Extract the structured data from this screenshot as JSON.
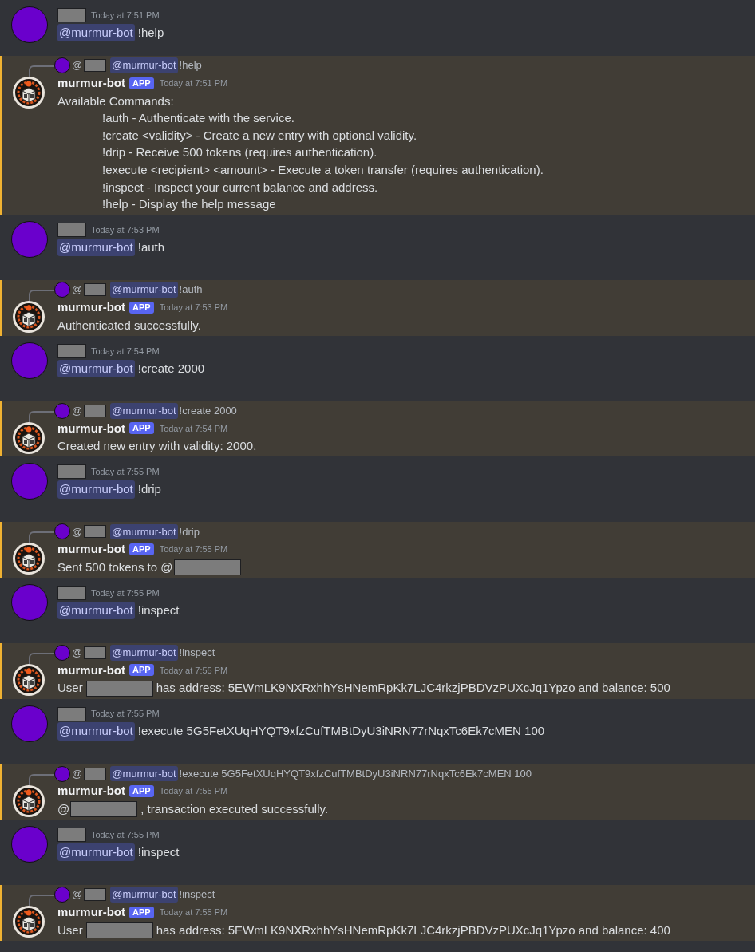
{
  "messages": [
    {
      "kind": "user",
      "time": "Today at 7:51 PM",
      "mention": "@murmur-bot",
      "command": "!help"
    },
    {
      "kind": "bot",
      "reply": {
        "at": "@",
        "mention": "@murmur-bot",
        "command": "!help"
      },
      "author": "murmur-bot",
      "badge": "APP",
      "time": "Today at 7:51 PM",
      "lines": [
        {
          "indented": false,
          "segments": [
            {
              "kind": "text",
              "text": "Available Commands:"
            }
          ]
        },
        {
          "indented": true,
          "segments": [
            {
              "kind": "text",
              "text": "!auth - Authenticate with the service."
            }
          ]
        },
        {
          "indented": true,
          "segments": [
            {
              "kind": "text",
              "text": "!create <validity> - Create a new entry with optional validity."
            }
          ]
        },
        {
          "indented": true,
          "segments": [
            {
              "kind": "text",
              "text": "!drip - Receive 500 tokens (requires authentication)."
            }
          ]
        },
        {
          "indented": true,
          "segments": [
            {
              "kind": "text",
              "text": "!execute <recipient> <amount> - Execute a token transfer (requires authentication)."
            }
          ]
        },
        {
          "indented": true,
          "segments": [
            {
              "kind": "text",
              "text": "!inspect - Inspect your current balance and address."
            }
          ]
        },
        {
          "indented": true,
          "segments": [
            {
              "kind": "text",
              "text": "!help - Display the help message"
            }
          ]
        }
      ]
    },
    {
      "kind": "user",
      "time": "Today at 7:53 PM",
      "mention": "@murmur-bot",
      "command": "!auth"
    },
    {
      "kind": "bot",
      "reply": {
        "at": "@",
        "mention": "@murmur-bot",
        "command": "!auth"
      },
      "author": "murmur-bot",
      "badge": "APP",
      "time": "Today at 7:53 PM",
      "lines": [
        {
          "indented": false,
          "segments": [
            {
              "kind": "text",
              "text": "Authenticated successfully."
            }
          ]
        }
      ]
    },
    {
      "kind": "user",
      "time": "Today at 7:54 PM",
      "mention": "@murmur-bot",
      "command": "!create 2000"
    },
    {
      "kind": "bot",
      "reply": {
        "at": "@",
        "mention": "@murmur-bot",
        "command": "!create 2000"
      },
      "author": "murmur-bot",
      "badge": "APP",
      "time": "Today at 7:54 PM",
      "lines": [
        {
          "indented": false,
          "segments": [
            {
              "kind": "text",
              "text": "Created new entry with validity: 2000."
            }
          ]
        }
      ]
    },
    {
      "kind": "user",
      "time": "Today at 7:55 PM",
      "mention": "@murmur-bot",
      "command": "!drip"
    },
    {
      "kind": "bot",
      "reply": {
        "at": "@",
        "mention": "@murmur-bot",
        "command": "!drip"
      },
      "author": "murmur-bot",
      "badge": "APP",
      "time": "Today at 7:55 PM",
      "lines": [
        {
          "indented": false,
          "segments": [
            {
              "kind": "text",
              "text": "Sent 500 tokens to @"
            },
            {
              "kind": "redacted"
            }
          ]
        }
      ]
    },
    {
      "kind": "user",
      "time": "Today at 7:55 PM",
      "mention": "@murmur-bot",
      "command": "!inspect"
    },
    {
      "kind": "bot",
      "reply": {
        "at": "@",
        "mention": "@murmur-bot",
        "command": "!inspect"
      },
      "author": "murmur-bot",
      "badge": "APP",
      "time": "Today at 7:55 PM",
      "lines": [
        {
          "indented": false,
          "segments": [
            {
              "kind": "text",
              "text": "User"
            },
            {
              "kind": "redacted"
            },
            {
              "kind": "text",
              "text": "has address: 5EWmLK9NXRxhhYsHNemRpKk7LJC4rkzjPBDVzPUXcJq1Ypzo and balance: 500"
            }
          ]
        }
      ]
    },
    {
      "kind": "user",
      "time": "Today at 7:55 PM",
      "mention": "@murmur-bot",
      "command": "!execute 5G5FetXUqHYQT9xfzCufTMBtDyU3iNRN77rNqxTc6Ek7cMEN 100"
    },
    {
      "kind": "bot",
      "reply": {
        "at": "@",
        "mention": "@murmur-bot",
        "command": "!execute 5G5FetXUqHYQT9xfzCufTMBtDyU3iNRN77rNqxTc6Ek7cMEN 100"
      },
      "author": "murmur-bot",
      "badge": "APP",
      "time": "Today at 7:55 PM",
      "lines": [
        {
          "indented": false,
          "segments": [
            {
              "kind": "text",
              "text": "@"
            },
            {
              "kind": "redacted"
            },
            {
              "kind": "text",
              "text": ", transaction executed successfully."
            }
          ]
        }
      ]
    },
    {
      "kind": "user",
      "time": "Today at 7:55 PM",
      "mention": "@murmur-bot",
      "command": "!inspect"
    },
    {
      "kind": "bot",
      "reply": {
        "at": "@",
        "mention": "@murmur-bot",
        "command": "!inspect"
      },
      "author": "murmur-bot",
      "badge": "APP",
      "time": "Today at 7:55 PM",
      "lines": [
        {
          "indented": false,
          "segments": [
            {
              "kind": "text",
              "text": "User"
            },
            {
              "kind": "redacted"
            },
            {
              "kind": "text",
              "text": "has address: 5EWmLK9NXRxhhYsHNemRpKk7LJC4rkzjPBDVzPUXcJq1Ypzo and balance: 400"
            }
          ]
        }
      ]
    }
  ]
}
